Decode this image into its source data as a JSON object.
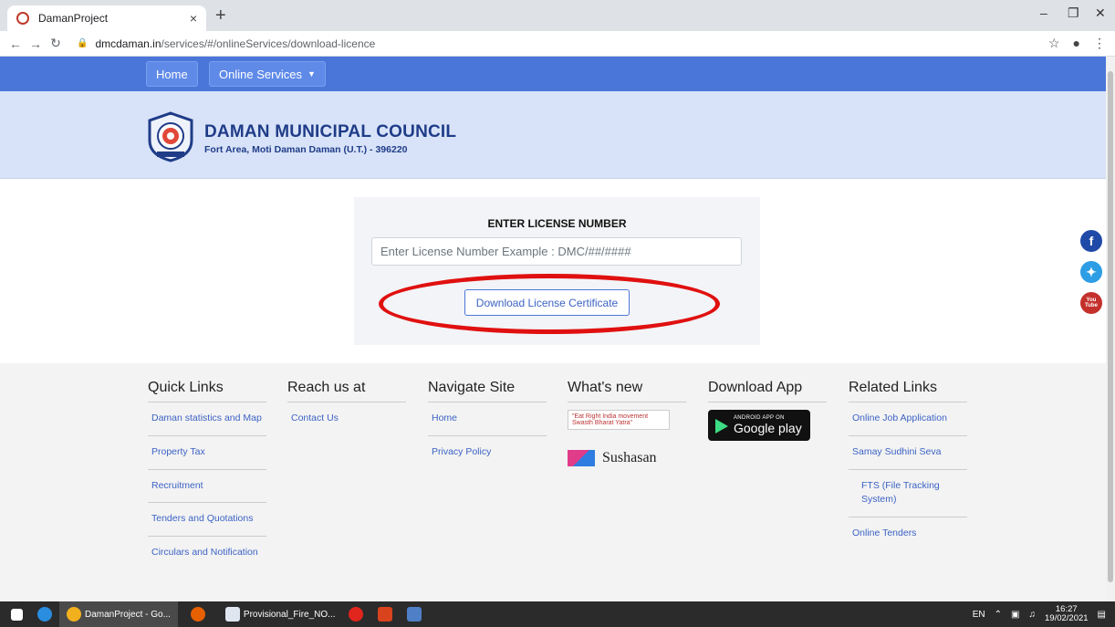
{
  "browser": {
    "tab_title": "DamanProject",
    "tab_close": "×",
    "new_tab": "+",
    "url_host": "dmcdaman.in",
    "url_path": "/services/#/onlineServices/download-licence",
    "icons": [
      "back-icon",
      "forward-icon",
      "reload-icon",
      "lock-icon",
      "star-icon",
      "profile-icon",
      "menu-icon"
    ]
  },
  "navbar": {
    "home_label": "Home",
    "services_label": "Online Services"
  },
  "header": {
    "org_name": "DAMAN MUNICIPAL COUNCIL",
    "org_address": "Fort Area, Moti Daman Daman (U.T.) - 396220"
  },
  "form": {
    "title": "ENTER LICENSE NUMBER",
    "input_placeholder": "Enter License Number Example : DMC/##/####",
    "input_value": "",
    "download_button": "Download License Certificate",
    "highlight_color": "#e01010"
  },
  "social": {
    "facebook": "f",
    "twitter": "t",
    "youtube": "You Tube",
    "colors": {
      "facebook": "#1f4aa8",
      "twitter": "#2d9de5",
      "youtube": "#c4302b"
    }
  },
  "footer": {
    "quick_links": {
      "heading": "Quick Links",
      "items": [
        "Daman statistics and Map",
        "Property Tax",
        "Recruitment",
        "Tenders and Quotations",
        "Circulars and Notification"
      ]
    },
    "reach_us": {
      "heading": "Reach us at",
      "items": [
        "Contact Us"
      ]
    },
    "navigate": {
      "heading": "Navigate Site",
      "items": [
        "Home",
        "Privacy Policy"
      ]
    },
    "whats_new": {
      "heading": "What's new",
      "swachh_text": "\"Eat Right India movement Swasth Bharat Yatra\"",
      "sushasan_text": "Sushasan"
    },
    "download_app": {
      "heading": "Download App",
      "small": "ANDROID APP ON",
      "big": "Google play"
    },
    "related": {
      "heading": "Related Links",
      "items": [
        "Online Job Application",
        "Samay Sudhini Seva",
        "FTS (File Tracking System)",
        "Online Tenders"
      ]
    }
  },
  "taskbar": {
    "items": [
      "DamanProject - Go...",
      "Provisional_Fire_NO..."
    ],
    "lang": "EN",
    "time": "16:27",
    "date": "19/02/2021"
  }
}
